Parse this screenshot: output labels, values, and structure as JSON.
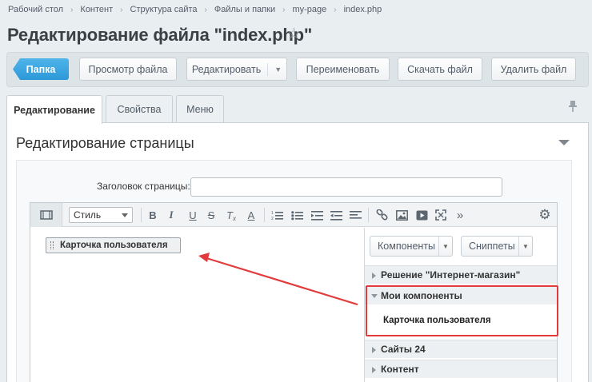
{
  "breadcrumb": [
    "Рабочий стол",
    "Контент",
    "Структура сайта",
    "Файлы и папки",
    "my-page",
    "index.php"
  ],
  "breadcrumb_sep": "›",
  "page_title": "Редактирование файла \"index.php\"",
  "icons": {
    "favorite": "star-icon",
    "pin": "pin-icon",
    "settings": "gear-icon"
  },
  "toolbar": {
    "folder": "Папка",
    "view_file": "Просмотр файла",
    "edit": "Редактировать",
    "rename": "Переименовать",
    "download": "Скачать файл",
    "delete": "Удалить файл"
  },
  "tabs": [
    "Редактирование",
    "Свойства",
    "Меню"
  ],
  "section_title": "Редактирование страницы",
  "form": {
    "page_title_label": "Заголовок страницы:",
    "page_title_value": ""
  },
  "editor": {
    "style_select": "Стиль",
    "toolbar_icons": [
      "bold-icon",
      "italic-icon",
      "underline-icon",
      "strikethrough-icon",
      "clear-format-icon",
      "font-color-icon",
      "ordered-list-icon",
      "unordered-list-icon",
      "indent-icon",
      "outdent-icon",
      "align-icon",
      "link-icon",
      "image-icon",
      "video-icon",
      "fullscreen-icon",
      "more-icon"
    ],
    "component_block": "Карточка пользователя"
  },
  "sidebar": {
    "components_btn": "Компоненты",
    "snippets_btn": "Сниппеты",
    "groups": [
      {
        "label": "Решение \"Интернет-магазин\"",
        "open": false
      },
      {
        "label": "Мои компоненты",
        "open": true
      },
      {
        "label": "Сайты 24",
        "open": false
      },
      {
        "label": "Контент",
        "open": false
      }
    ],
    "my_components_item": "Карточка пользователя"
  },
  "colors": {
    "accent": "#2c98d8",
    "highlight": "#e23b3b"
  }
}
